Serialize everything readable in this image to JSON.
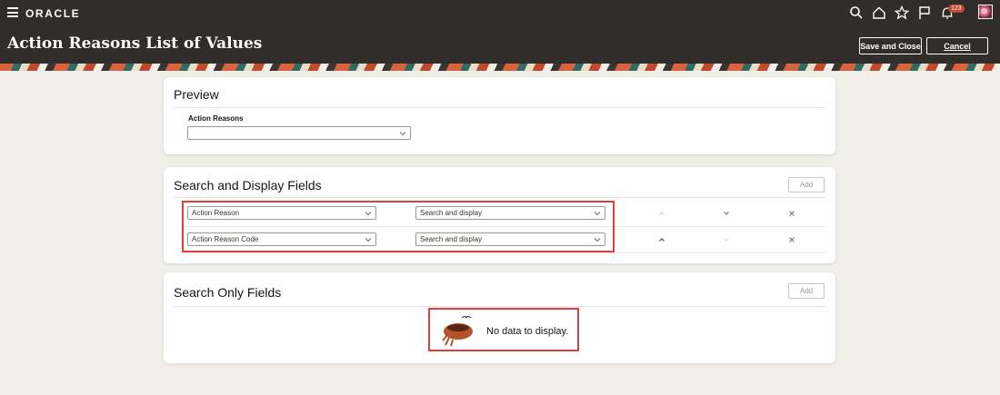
{
  "topbar": {
    "brand": "ORACLE",
    "notification_count": "123",
    "icons": [
      "menu-icon",
      "search-icon",
      "home-icon",
      "star-icon",
      "flag-icon",
      "bell-icon",
      "user-avatar"
    ]
  },
  "header": {
    "title": "Action Reasons List of Values",
    "save_close_label": "Save and Close",
    "cancel_label": "Cancel"
  },
  "preview": {
    "title": "Preview",
    "field_label": "Action Reasons",
    "field_value": ""
  },
  "search_display": {
    "title": "Search and Display Fields",
    "add_label": "Add",
    "rows": [
      {
        "field": "Action Reason",
        "mode": "Search and display"
      },
      {
        "field": "Action Reason Code",
        "mode": "Search and display"
      }
    ]
  },
  "search_only": {
    "title": "Search Only Fields",
    "add_label": "Add",
    "empty_text": "No data to display."
  },
  "colors": {
    "topbar": "#312d2a",
    "highlight": "#e23d3d",
    "badge": "#c74634",
    "page_bg": "#f1efea"
  }
}
